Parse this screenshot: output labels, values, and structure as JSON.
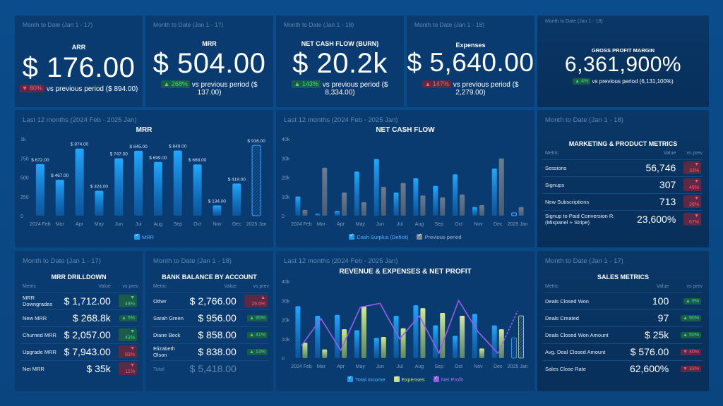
{
  "colors": {
    "background": "#0b4c8c",
    "panel": "#0a3b70",
    "accent_blue": "#1a9cf0",
    "previous_gray": "#5b6f86",
    "expenses_green": "#c5e08a",
    "net_profit_purple": "#9b5cf0",
    "badge_up": "#3ddc84",
    "badge_down": "#ff5a6e"
  },
  "kpis": [
    {
      "subtitle": "Month to Date (Jan 1 - 17)",
      "title": "ARR",
      "value": "$ 176.00",
      "change": "80%",
      "direction": "down",
      "sentiment": "bad",
      "comparison": "vs previous period ($ 894.00)"
    },
    {
      "subtitle": "Month to Date (Jan 1 - 17)",
      "title": "MRR",
      "value": "$ 504.00",
      "change": "268%",
      "direction": "up",
      "sentiment": "good",
      "comparison": "vs previous period ($",
      "comparison2": "137.00)"
    },
    {
      "subtitle": "Month to Date (Jan 1 - 18)",
      "title": "NET CASH FLOW (BURN)",
      "value": "$ 20.2k",
      "change": "143%",
      "direction": "up",
      "sentiment": "good",
      "comparison": "vs previous period ($",
      "comparison2": "8,334.00)"
    },
    {
      "subtitle": "Month to Date (Jan 1 - 18)",
      "title": "Expenses",
      "value": "$ 5,640.00",
      "change": "147%",
      "direction": "up",
      "sentiment": "bad",
      "comparison": "vs previous period ($",
      "comparison2": "2,279.00)"
    },
    {
      "subtitle": "Month to Date (Jan 1 - 18)",
      "title": "GROSS PROFIT MARGIN",
      "value": "6,361,900%",
      "change": "4%",
      "direction": "up",
      "sentiment": "good",
      "comparison": "vs previous period (6,131,100%)"
    }
  ],
  "chart_data": [
    {
      "id": "mrr",
      "type": "bar",
      "subtitle": "Last 12 months (2024 Feb - 2025 Jan)",
      "title": "MRR",
      "categories": [
        "2024 Feb",
        "Mar",
        "Apr",
        "May",
        "Jun",
        "Jul",
        "Aug",
        "Sep",
        "Oct",
        "Nov",
        "Dec",
        "2025 Jan"
      ],
      "series": [
        {
          "name": "MRR",
          "values": [
            672,
            467,
            874,
            324,
            747,
            845,
            699,
            849,
            668,
            134,
            419,
            916
          ]
        }
      ],
      "data_labels": [
        "$ 672.00",
        "$ 467.00",
        "$ 874.00",
        "$ 324.00",
        "$ 747.00",
        "$ 845.00",
        "$ 699.00",
        "$ 849.00",
        "$ 668.00",
        "$ 134.00",
        "$ 419.00",
        "$ 916.00"
      ],
      "partial_last": true,
      "yticks": [
        "0",
        "250",
        "500",
        "750",
        "1k"
      ],
      "ylim": [
        0,
        1000
      ],
      "legend": [
        "MRR"
      ],
      "legend_position": "bottom"
    },
    {
      "id": "net_cash_flow",
      "type": "bar",
      "subtitle": "Last 12 months (2024 Feb - 2025 Jan)",
      "title": "NET CASH FLOW",
      "categories": [
        "2024 Feb",
        "Mar",
        "Apr",
        "May",
        "Jun",
        "Jul",
        "Aug",
        "Sep",
        "Oct",
        "Nov",
        "Dec",
        "2025 Jan"
      ],
      "series": [
        {
          "name": "Cash Surplus (Deficit)",
          "values": [
            10000,
            1000,
            2500,
            23000,
            29500,
            12000,
            19500,
            15500,
            21500,
            4500,
            24500,
            1500
          ]
        },
        {
          "name": "Previous period",
          "values": [
            3000,
            25000,
            12000,
            7000,
            15000,
            17000,
            10500,
            9500,
            11000,
            5500,
            29800,
            4500
          ]
        }
      ],
      "partial_last": true,
      "yticks": [
        "0",
        "10k",
        "20k",
        "30k",
        "40k"
      ],
      "ylim": [
        0,
        40000
      ],
      "legend_position": "bottom"
    },
    {
      "id": "rev_exp_profit",
      "type": "bar",
      "subtitle": "Last 12 months (2024 Feb - 2025 Jan)",
      "title": "REVENUE & EXPENSES & NET PROFIT",
      "categories": [
        "2024 Feb",
        "Mar",
        "Apr",
        "May",
        "Jun",
        "Jul",
        "Aug",
        "Sep",
        "Oct",
        "Nov",
        "Dec",
        "2025 Jan"
      ],
      "series": [
        {
          "name": "Total Income",
          "type": "bar",
          "values": [
            27000,
            22000,
            22500,
            14500,
            10500,
            22000,
            27500,
            17000,
            11500,
            23000,
            17000,
            10500
          ]
        },
        {
          "name": "Expenses",
          "type": "bar",
          "values": [
            8000,
            4500,
            15000,
            27000,
            11000,
            15500,
            26000,
            23500,
            22000,
            5000,
            15000,
            22000
          ]
        },
        {
          "name": "Net Profit",
          "type": "line",
          "values": [
            6500,
            20500,
            4000,
            26500,
            28500,
            10000,
            22000,
            2500,
            30000,
            13500,
            2500,
            24500
          ]
        }
      ],
      "partial_last": true,
      "yticks": [
        "0",
        "10k",
        "20k",
        "30k",
        "40k"
      ],
      "ylim": [
        0,
        40000
      ],
      "legend_position": "bottom"
    }
  ],
  "marketing": {
    "subtitle": "Month to Date (Jan 1 - 18)",
    "title": "MARKETING & PRODUCT METRICS",
    "headers": [
      "Metric",
      "Value",
      "vs prev"
    ],
    "rows": [
      {
        "metric": "Sessions",
        "value": "56,746",
        "change": "33%",
        "direction": "down",
        "sentiment": "bad"
      },
      {
        "metric": "Signups",
        "value": "307",
        "change": "49%",
        "direction": "down",
        "sentiment": "bad"
      },
      {
        "metric": "New Subscriptions",
        "value": "713",
        "change": "28%",
        "direction": "down",
        "sentiment": "bad"
      },
      {
        "metric": "Signup to Paid Conversion R. (Mixpanel + Stripe)",
        "value": "23,600%",
        "change": "67%",
        "direction": "down",
        "sentiment": "bad"
      }
    ]
  },
  "mrr_drilldown": {
    "subtitle": "Month to Date (Jan 1 - 17)",
    "title": "MRR DRILLDOWN",
    "headers": [
      "Metric",
      "Value",
      "vs prev"
    ],
    "rows": [
      {
        "metric": "MRR Downgrades",
        "value": "$ 1,712.00",
        "change": "48%",
        "direction": "down",
        "sentiment": "good"
      },
      {
        "metric": "New MRR",
        "value": "$ 268.8k",
        "change": "5%",
        "direction": "up",
        "sentiment": "good"
      },
      {
        "metric": "Churned MRR",
        "value": "$ 2,057.00",
        "change": "43%",
        "direction": "down",
        "sentiment": "good"
      },
      {
        "metric": "Upgrade MRR",
        "value": "$ 7,943.00",
        "change": "83%",
        "direction": "down",
        "sentiment": "bad"
      },
      {
        "metric": "Net MRR",
        "value": "$ 35k",
        "change": "11%",
        "direction": "down",
        "sentiment": "bad"
      }
    ]
  },
  "bank_balance": {
    "subtitle": "Month to Date (Jan 1 - 18)",
    "title": "BANK BALANCE BY ACCOUNT",
    "headers": [
      "Metric",
      "Value",
      "vs prev"
    ],
    "rows": [
      {
        "metric": "Other",
        "value": "$ 2,766.00",
        "change": "19.6%",
        "direction": "up",
        "sentiment": "bad"
      },
      {
        "metric": "Sarah Green",
        "value": "$ 956.00",
        "change": "95%",
        "direction": "up",
        "sentiment": "good"
      },
      {
        "metric": "Diane Beck",
        "value": "$ 858.00",
        "change": "41%",
        "direction": "up",
        "sentiment": "good"
      },
      {
        "metric": "Elizabeth Olson",
        "value": "$ 838.00",
        "change": "13%",
        "direction": "up",
        "sentiment": "good"
      }
    ],
    "total_label": "Total",
    "total_value": "$ 5,418.00"
  },
  "sales": {
    "subtitle": "Month to Date (Jan 1 - 17)",
    "title": "SALES METRICS",
    "headers": [
      "Metric",
      "Value",
      "vs prev"
    ],
    "rows": [
      {
        "metric": "Deals Closed Won",
        "value": "100",
        "change": "9%",
        "direction": "up",
        "sentiment": "good"
      },
      {
        "metric": "Deals Created",
        "value": "97",
        "change": "90%",
        "direction": "up",
        "sentiment": "good"
      },
      {
        "metric": "Deals Closed Won Amount",
        "value": "$ 25k",
        "change": "50%",
        "direction": "up",
        "sentiment": "good"
      },
      {
        "metric": "Avg. Deal Closed Amount",
        "value": "$ 576.00",
        "change": "40%",
        "direction": "down",
        "sentiment": "bad"
      },
      {
        "metric": "Sales Close Rate",
        "value": "62,600%",
        "change": "33%",
        "direction": "down",
        "sentiment": "bad"
      }
    ]
  }
}
